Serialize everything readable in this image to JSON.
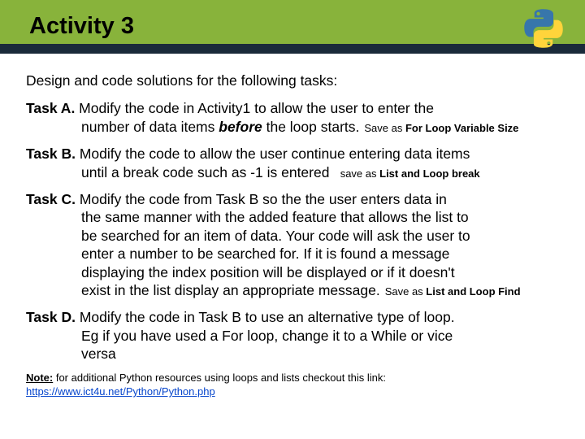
{
  "header": {
    "title": "Activity 3",
    "logo_alt": "python-logo"
  },
  "intro": "Design and code solutions for the following tasks:",
  "tasks": {
    "a": {
      "label": "Task A. ",
      "line1": "Modify the code in Activity1 to allow the user to enter the",
      "line2_prefix": "number of data items ",
      "line2_bold": "before",
      "line2_suffix": " the loop starts.",
      "save_prefix": "Save as ",
      "save_name": "For Loop Variable Size"
    },
    "b": {
      "label": "Task B. ",
      "line1": "Modify the code to allow the user continue entering data items",
      "line2": "until a break code such as -1 is entered",
      "save_prefix": "save as ",
      "save_name": "List and Loop break"
    },
    "c": {
      "label": "Task C. ",
      "line1": "Modify the code from Task B so the the user enters data in",
      "line2": "the same manner with the added feature that allows the list to",
      "line3": "be searched for an item of data. Your code will ask the user to",
      "line4": "enter a number to be searched for. If it is found a message",
      "line5": "displaying the index position will be displayed or if it doesn't",
      "line6": "exist in the list display an appropriate message.",
      "save_prefix": "Save as ",
      "save_name": "List and Loop Find"
    },
    "d": {
      "label": "Task D. ",
      "line1": "Modify the code in Task B to use an alternative type of loop.",
      "line2": "Eg if you have used a For loop, change it to a While or vice",
      "line3": "versa"
    }
  },
  "note": {
    "label": "Note:",
    "text": " for additional Python resources using loops and lists checkout this link:",
    "link": "https://www.ict4u.net/Python/Python.php"
  }
}
